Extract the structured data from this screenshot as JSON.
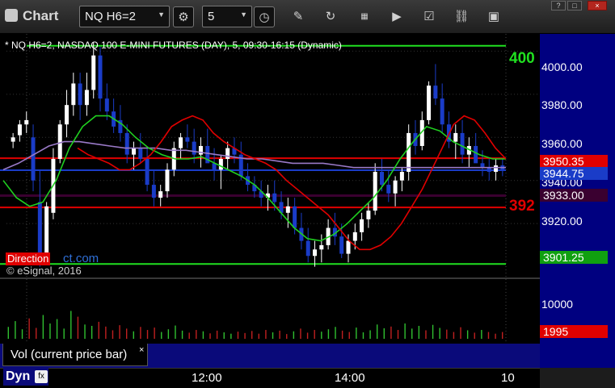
{
  "toolbar": {
    "title": "Chart",
    "symbol": "NQ H6=2",
    "interval": "5",
    "window_buttons": [
      "?",
      "□",
      "×"
    ]
  },
  "chart": {
    "description": "* NQ H6=2, NASDAQ 100 E-MINI FUTURES (DAY), 5, 09:30-16:15 (Dynamic)",
    "watermark": "© eSignal, 2016",
    "direction_badge": "Direction",
    "direction_link": "ct.com",
    "line_label_green": "400",
    "line_label_red": "392"
  },
  "axis": {
    "ticks": [
      "4000.00",
      "3980.00",
      "3960.00",
      "3940.00",
      "3920.00"
    ],
    "vol_tick": "10000",
    "price_tags": [
      {
        "text": "3950.35",
        "color": "#e00000"
      },
      {
        "text": "3944.75",
        "color": "#1a3cc8"
      },
      {
        "text": "3933.00",
        "color": "#3a0030"
      },
      {
        "text": "3901.25",
        "color": "#10a010"
      }
    ],
    "vol_tag": "1995"
  },
  "study": {
    "label": "Vol (current price bar)",
    "close": "×"
  },
  "timeaxis": {
    "labels": [
      "12:00",
      "14:00",
      "10"
    ],
    "dyn": "Dyn"
  },
  "colors": {
    "up": "#ffffff",
    "down": "#1a3cc8",
    "ma_fast": "#e00000",
    "ma_mid": "#20d020",
    "ma_slow": "#9a7ac8",
    "level_green": "#20e020",
    "level_red": "#e00000",
    "level_purple": "#3a0030"
  },
  "chart_data": {
    "type": "candlestick",
    "title": "NQ H6=2, NASDAQ 100 E-MINI FUTURES (DAY), 5, 09:30-16:15 (Dynamic)",
    "ylim": [
      3895,
      4008
    ],
    "yticks": [
      4000,
      3980,
      3960,
      3940,
      3920
    ],
    "x_ticks": [
      "12:00",
      "14:00",
      "10"
    ],
    "levels": [
      {
        "name": "400",
        "value": 4002.5,
        "color": "#20e020"
      },
      {
        "name": "",
        "value": 3950.35,
        "color": "#e00000"
      },
      {
        "name": "",
        "value": 3944.75,
        "color": "#1a3cc8"
      },
      {
        "name": "",
        "value": 3933.0,
        "color": "#3a0030"
      },
      {
        "name": "392",
        "value": 3927.5,
        "color": "#e00000"
      },
      {
        "name": "",
        "value": 3901.25,
        "color": "#20e020"
      }
    ],
    "candles": [
      [
        3958,
        3962,
        3955,
        3960
      ],
      [
        3961,
        3968,
        3958,
        3966
      ],
      [
        3966,
        3972,
        3962,
        3968
      ],
      [
        3960,
        3966,
        3935,
        3940
      ],
      [
        3930,
        3945,
        3900,
        3905
      ],
      [
        3905,
        3930,
        3902,
        3928
      ],
      [
        3925,
        3955,
        3922,
        3950
      ],
      [
        3950,
        3968,
        3948,
        3966
      ],
      [
        3966,
        3982,
        3960,
        3975
      ],
      [
        3975,
        3990,
        3970,
        3985
      ],
      [
        3985,
        3990,
        3968,
        3975
      ],
      [
        3975,
        3990,
        3970,
        3982
      ],
      [
        3982,
        4004,
        3978,
        3998
      ],
      [
        3998,
        4002,
        3972,
        3978
      ],
      [
        3978,
        3985,
        3968,
        3972
      ],
      [
        3972,
        3978,
        3962,
        3965
      ],
      [
        3968,
        3975,
        3958,
        3962
      ],
      [
        3962,
        3966,
        3948,
        3952
      ],
      [
        3952,
        3958,
        3945,
        3955
      ],
      [
        3955,
        3962,
        3948,
        3950
      ],
      [
        3950,
        3955,
        3935,
        3938
      ],
      [
        3938,
        3945,
        3928,
        3932
      ],
      [
        3932,
        3938,
        3928,
        3935
      ],
      [
        3935,
        3948,
        3932,
        3945
      ],
      [
        3945,
        3958,
        3942,
        3955
      ],
      [
        3955,
        3962,
        3950,
        3960
      ],
      [
        3960,
        3966,
        3955,
        3958
      ],
      [
        3958,
        3964,
        3948,
        3952
      ],
      [
        3952,
        3960,
        3946,
        3956
      ],
      [
        3956,
        3964,
        3952,
        3948
      ],
      [
        3948,
        3955,
        3940,
        3945
      ],
      [
        3945,
        3952,
        3936,
        3950
      ],
      [
        3950,
        3958,
        3945,
        3955
      ],
      [
        3955,
        3960,
        3948,
        3952
      ],
      [
        3952,
        3958,
        3940,
        3942
      ],
      [
        3942,
        3948,
        3935,
        3938
      ],
      [
        3938,
        3942,
        3932,
        3935
      ],
      [
        3935,
        3940,
        3928,
        3932
      ],
      [
        3932,
        3938,
        3926,
        3934
      ],
      [
        3934,
        3940,
        3926,
        3930
      ],
      [
        3930,
        3935,
        3922,
        3925
      ],
      [
        3925,
        3932,
        3918,
        3928
      ],
      [
        3928,
        3932,
        3915,
        3918
      ],
      [
        3918,
        3925,
        3908,
        3912
      ],
      [
        3912,
        3918,
        3902,
        3905
      ],
      [
        3905,
        3912,
        3900,
        3908
      ],
      [
        3908,
        3915,
        3902,
        3910
      ],
      [
        3910,
        3922,
        3908,
        3918
      ],
      [
        3918,
        3925,
        3910,
        3914
      ],
      [
        3914,
        3920,
        3904,
        3906
      ],
      [
        3906,
        3915,
        3902,
        3912
      ],
      [
        3912,
        3920,
        3908,
        3916
      ],
      [
        3916,
        3925,
        3912,
        3922
      ],
      [
        3922,
        3930,
        3918,
        3926
      ],
      [
        3926,
        3948,
        3924,
        3944
      ],
      [
        3944,
        3950,
        3935,
        3938
      ],
      [
        3938,
        3945,
        3930,
        3934
      ],
      [
        3934,
        3942,
        3928,
        3940
      ],
      [
        3940,
        3946,
        3935,
        3944
      ],
      [
        3944,
        3966,
        3940,
        3962
      ],
      [
        3962,
        3968,
        3952,
        3956
      ],
      [
        3956,
        3972,
        3954,
        3968
      ],
      [
        3968,
        3986,
        3966,
        3984
      ],
      [
        3984,
        3994,
        3975,
        3978
      ],
      [
        3978,
        3985,
        3962,
        3966
      ],
      [
        3966,
        3972,
        3955,
        3958
      ],
      [
        3958,
        3966,
        3950,
        3962
      ],
      [
        3962,
        3968,
        3948,
        3952
      ],
      [
        3952,
        3960,
        3946,
        3956
      ],
      [
        3956,
        3962,
        3950,
        3948
      ],
      [
        3948,
        3954,
        3942,
        3946
      ],
      [
        3946,
        3950,
        3940,
        3944
      ],
      [
        3944,
        3950,
        3940,
        3947
      ],
      [
        3947,
        3950,
        3942,
        3945
      ]
    ],
    "ma_red": [
      3955,
      3952,
      3950,
      3948,
      3945,
      3945,
      3948,
      3952,
      3958,
      3965,
      3968,
      3970,
      3968,
      3962,
      3958,
      3955,
      3952,
      3950,
      3948,
      3945,
      3940,
      3936,
      3932,
      3928,
      3924,
      3918,
      3912,
      3908,
      3908,
      3910,
      3914,
      3920,
      3928,
      3936,
      3946,
      3956,
      3966,
      3970,
      3968,
      3962,
      3955,
      3950
    ],
    "ma_green": [
      3940,
      3932,
      3928,
      3930,
      3940,
      3955,
      3965,
      3970,
      3970,
      3966,
      3960,
      3955,
      3952,
      3950,
      3950,
      3951,
      3948,
      3945,
      3942,
      3938,
      3932,
      3925,
      3918,
      3913,
      3912,
      3915,
      3920,
      3926,
      3932,
      3940,
      3950,
      3958,
      3965,
      3963,
      3958,
      3955,
      3952,
      3950,
      3950
    ],
    "ma_purple": [
      3945,
      3948,
      3952,
      3956,
      3958,
      3958,
      3957,
      3956,
      3955,
      3955,
      3955,
      3954,
      3954,
      3953,
      3952,
      3951,
      3950,
      3950,
      3949,
      3948,
      3948,
      3948,
      3947,
      3946,
      3946,
      3946,
      3946,
      3946,
      3946,
      3946,
      3946,
      3946,
      3946,
      3946
    ],
    "volume": [
      3500,
      5200,
      2800,
      6000,
      3200,
      7000,
      4500,
      5800,
      3000,
      8200,
      6500,
      4200,
      3800,
      5000,
      3600,
      2500,
      4000,
      3000,
      2200,
      3500,
      2600,
      3300,
      2000,
      2800,
      3900,
      2400,
      1800,
      2600,
      2200,
      1600,
      2400,
      1900,
      1500,
      2100,
      1700,
      2300,
      1500,
      2600,
      1900,
      2400,
      1400,
      2200,
      3000,
      1800,
      2600,
      2100,
      2800,
      3500,
      2400,
      2000,
      3300,
      1900,
      2500,
      4200,
      3100,
      3600,
      2600,
      4500,
      3000,
      3800,
      2500,
      4100,
      3200,
      2700,
      2000,
      3400,
      2500,
      1800,
      2600,
      2000,
      1500,
      1995
    ]
  }
}
